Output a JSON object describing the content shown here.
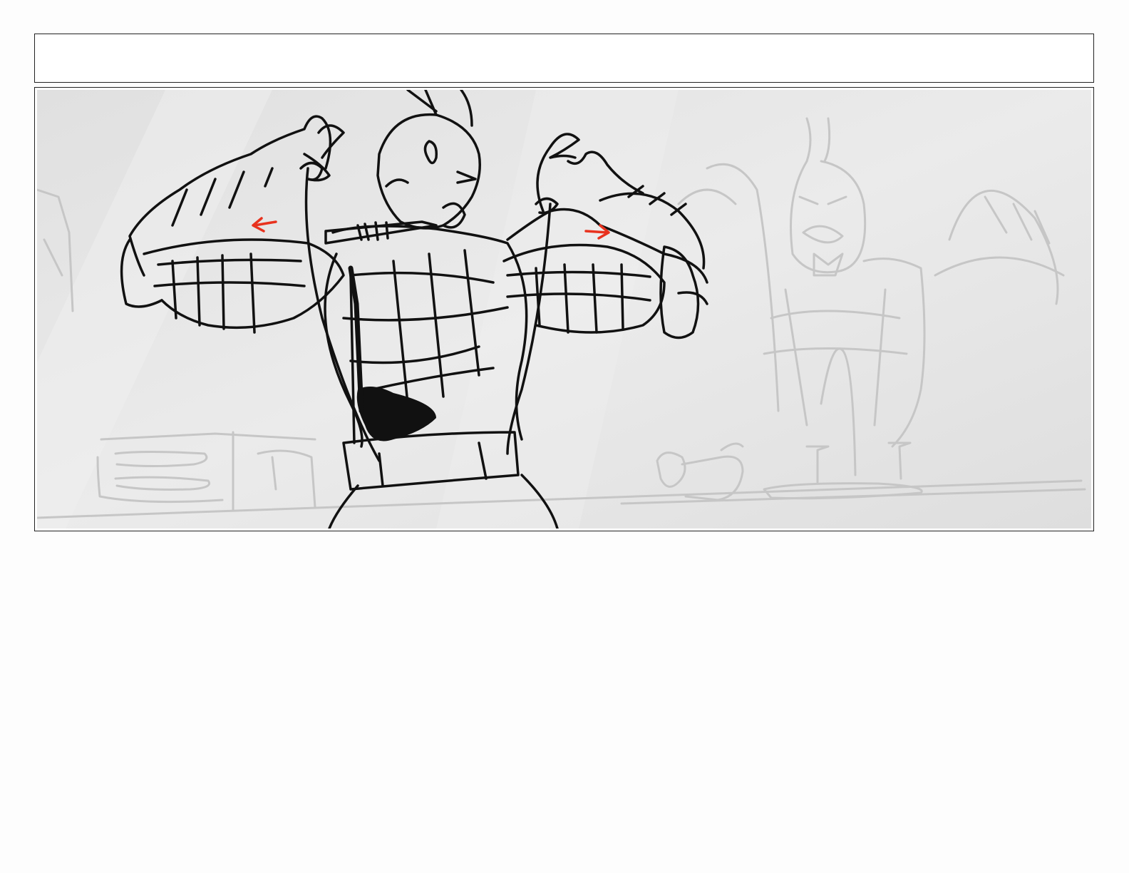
{
  "caption": {
    "text": ""
  },
  "panel": {
    "background_color": "#e6e6e6",
    "ink_color": "#111111",
    "ghost_color": "#c8c8c8",
    "arrow_color": "#e8321e",
    "left_arrow_icon": "arrow-left-icon",
    "right_arrow_icon": "arrow-right-icon"
  }
}
